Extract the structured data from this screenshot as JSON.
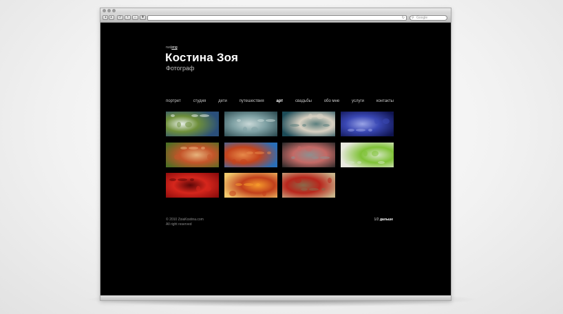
{
  "browser": {
    "search_placeholder": "Google",
    "nav_buttons": [
      "◂",
      "▸",
      "⟳",
      "+",
      "⌂",
      "✚"
    ],
    "reload_glyph": "↻"
  },
  "site": {
    "languages": [
      "rus",
      "eng"
    ],
    "active_language": "eng",
    "title": "Костина Зоя",
    "subtitle": "Фотограф"
  },
  "nav": {
    "items": [
      "портрет",
      "студия",
      "дети",
      "путешествия",
      "арт",
      "свадьбы",
      "обо мне",
      "услуги",
      "контакты"
    ],
    "active": "арт"
  },
  "gallery": {
    "thumbnails": [
      {
        "name": "snow-pine-branch",
        "colors": [
          "#2a4f7a",
          "#6e8f3a",
          "#e8efe9"
        ]
      },
      {
        "name": "frosted-branches",
        "colors": [
          "#2d4c52",
          "#7fa1a4",
          "#c9d8d7"
        ]
      },
      {
        "name": "white-blossoms-teal",
        "colors": [
          "#1c4b57",
          "#d9d1c2",
          "#5b7f7e"
        ]
      },
      {
        "name": "blue-night-grass",
        "colors": [
          "#0f1450",
          "#3a48b4",
          "#9aa4e6"
        ]
      },
      {
        "name": "autumn-leaves-green",
        "colors": [
          "#4e6e23",
          "#c4552a",
          "#e7b37c"
        ]
      },
      {
        "name": "red-leaves-blue-sky",
        "colors": [
          "#2a6fb8",
          "#c4441d",
          "#e78a4a"
        ]
      },
      {
        "name": "blossoms-dark",
        "colors": [
          "#2d2a2a",
          "#c46a66",
          "#8f8f8f"
        ]
      },
      {
        "name": "green-glass-white",
        "colors": [
          "#e9e9e0",
          "#7fc236",
          "#d3e5c1"
        ]
      },
      {
        "name": "red-rose",
        "colors": [
          "#8a0c0c",
          "#d6261c",
          "#5c0707"
        ]
      },
      {
        "name": "orange-agave",
        "colors": [
          "#f2c96c",
          "#c2401c",
          "#f59a2c"
        ]
      },
      {
        "name": "red-flowers-beige",
        "colors": [
          "#c9b48b",
          "#b8261c",
          "#8a6a4a"
        ]
      }
    ]
  },
  "footer": {
    "copyright": "© 2010 ZoiaKostina.com",
    "rights": "All right reserved"
  },
  "pager": {
    "position": "1/2",
    "next_label": "дальше"
  }
}
